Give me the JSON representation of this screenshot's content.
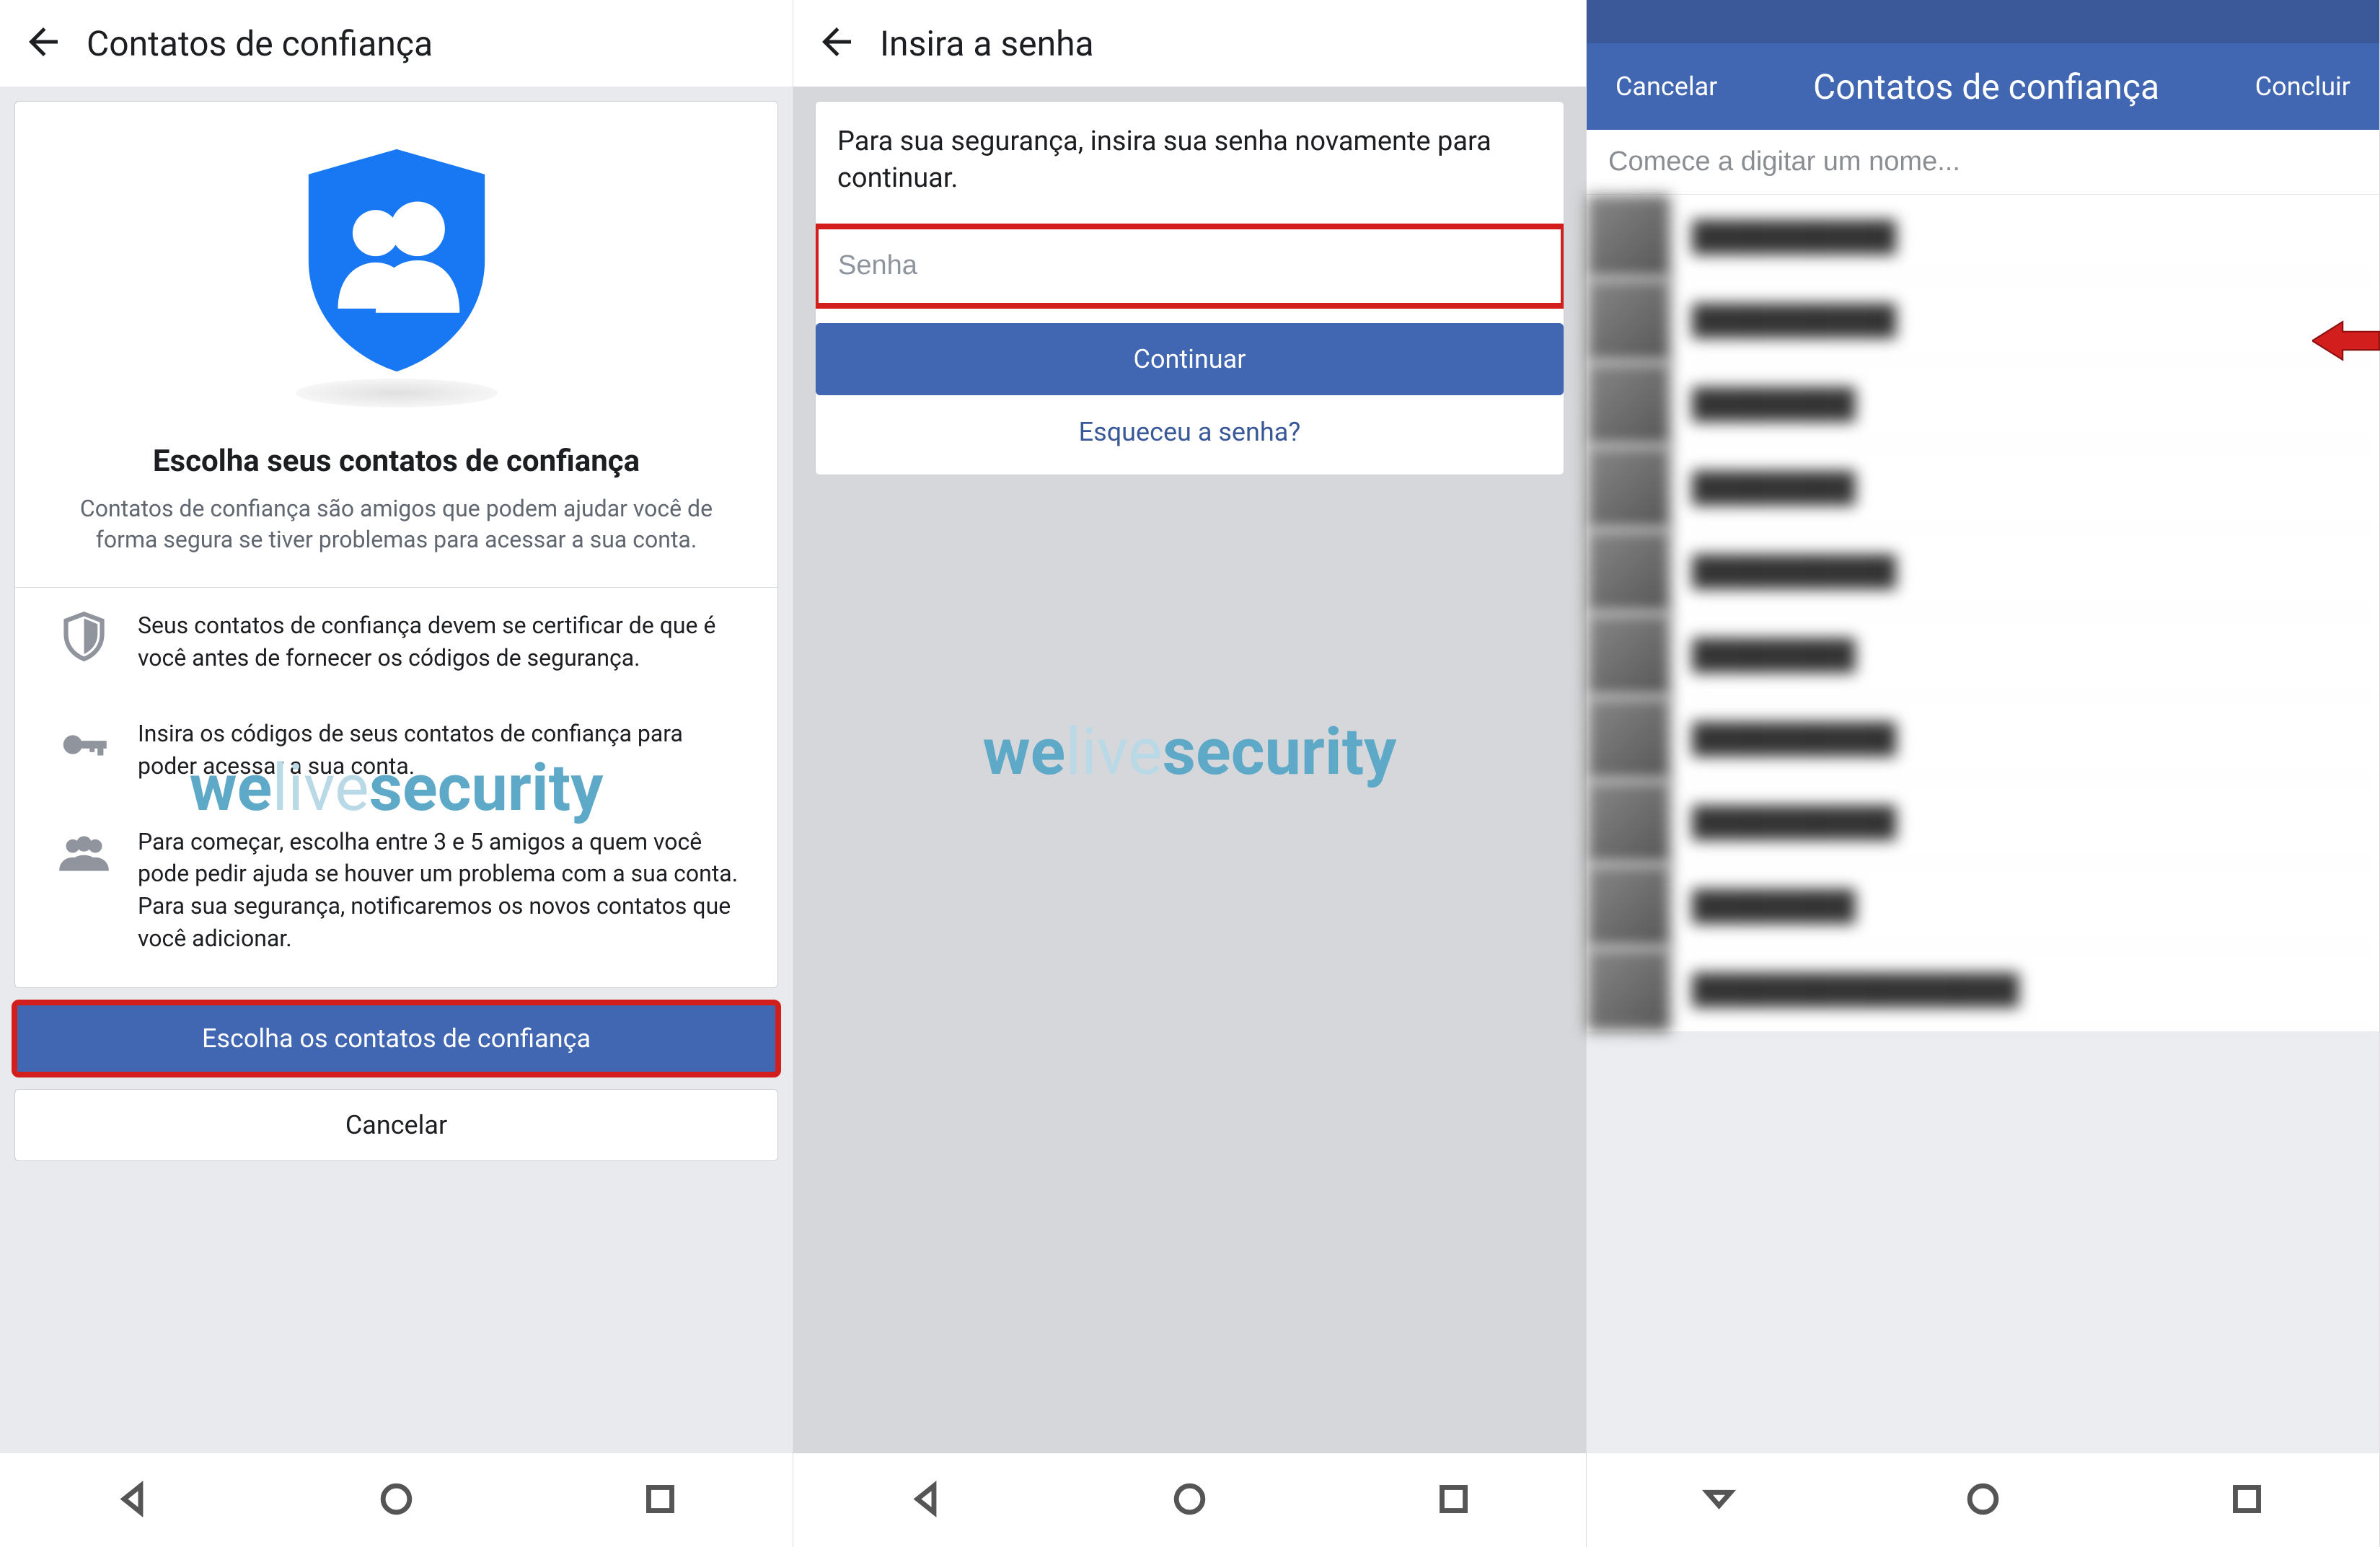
{
  "watermark": {
    "part1": "we",
    "part2": "live",
    "part3": "security"
  },
  "screen1": {
    "appbar_title": "Contatos de confiança",
    "card_heading": "Escolha seus contatos de confiança",
    "card_sub": "Contatos de confiança são amigos que podem ajudar você de forma segura se tiver problemas para acessar a sua conta.",
    "info1": "Seus contatos de confiança devem se certificar de que é você antes de fornecer os códigos de segurança.",
    "info2": "Insira os códigos de seus contatos de confiança para poder acessar a sua conta.",
    "info3": "Para começar, escolha entre 3 e 5 amigos a quem você pode pedir ajuda se houver um problema com a sua conta. Para sua segurança, notificaremos os novos contatos que você adicionar.",
    "primary_button": "Escolha os contatos de confiança",
    "secondary_button": "Cancelar"
  },
  "screen2": {
    "appbar_title": "Insira a senha",
    "instruction": "Para sua segurança, insira sua senha novamente para continuar.",
    "password_placeholder": "Senha",
    "continue_button": "Continuar",
    "forgot_link": "Esqueceu a senha?"
  },
  "screen3": {
    "cancel": "Cancelar",
    "title": "Contatos de confiança",
    "done": "Concluir",
    "search_placeholder": "Comece a digitar um nome...",
    "contacts": [
      "██████████",
      "██████████",
      "████████",
      "████████",
      "██████████",
      "████████",
      "██████████",
      "██████████",
      "████████",
      "████████████████"
    ]
  }
}
